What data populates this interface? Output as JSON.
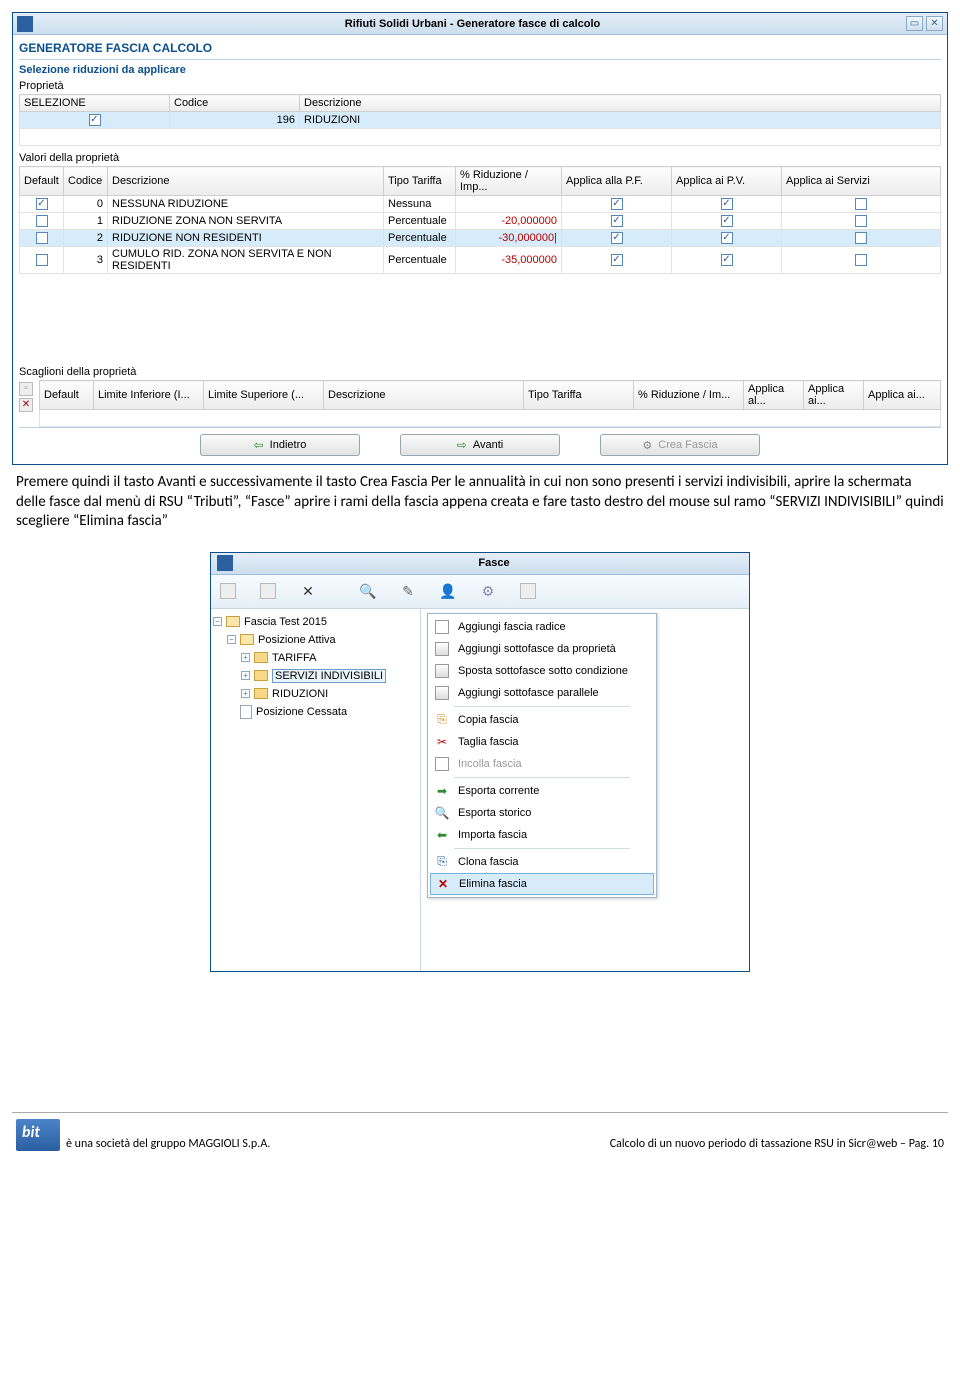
{
  "dialog": {
    "title": "Rifiuti Solidi Urbani - Generatore fasce di calcolo",
    "header": "GENERATORE FASCIA CALCOLO",
    "section1": "Selezione riduzioni da applicare",
    "proprieta_label": "Proprietà",
    "table1_headers": {
      "selezione": "SELEZIONE",
      "codice": "Codice",
      "descrizione": "Descrizione"
    },
    "table1_row": {
      "codice": "196",
      "descrizione": "RIDUZIONI"
    },
    "valori_label": "Valori della proprietà",
    "table2_headers": {
      "default": "Default",
      "codice": "Codice",
      "descrizione": "Descrizione",
      "tipo": "Tipo Tariffa",
      "perc": "% Riduzione / Imp...",
      "pf": "Applica alla P.F.",
      "pv": "Applica ai P.V.",
      "serv": "Applica ai Servizi"
    },
    "table2_rows": [
      {
        "default": true,
        "codice": "0",
        "descrizione": "NESSUNA RIDUZIONE",
        "tipo": "Nessuna",
        "perc": "",
        "pf": true,
        "pv": true,
        "serv": false,
        "sel": false
      },
      {
        "default": false,
        "codice": "1",
        "descrizione": "RIDUZIONE ZONA NON SERVITA",
        "tipo": "Percentuale",
        "perc": "-20,000000",
        "pf": true,
        "pv": true,
        "serv": false,
        "sel": false
      },
      {
        "default": false,
        "codice": "2",
        "descrizione": "RIDUZIONE NON RESIDENTI",
        "tipo": "Percentuale",
        "perc": "-30,000000|",
        "pf": true,
        "pv": true,
        "serv": false,
        "sel": true
      },
      {
        "default": false,
        "codice": "3",
        "descrizione": "CUMULO RID. ZONA NON SERVITA E NON RESIDENTI",
        "tipo": "Percentuale",
        "perc": "-35,000000",
        "pf": true,
        "pv": true,
        "serv": false,
        "sel": false
      }
    ],
    "scaglioni_label": "Scaglioni della proprietà",
    "table3_headers": {
      "default": "Default",
      "liminf": "Limite Inferiore (I...",
      "limsup": "Limite Superiore (...",
      "descrizione": "Descrizione",
      "tipo": "Tipo Tariffa",
      "perc": "% Riduzione / Im...",
      "a1": "Applica al...",
      "a2": "Applica ai...",
      "a3": "Applica ai..."
    },
    "buttons": {
      "indietro": "Indietro",
      "avanti": "Avanti",
      "crea": "Crea Fascia"
    }
  },
  "body_text": "Premere quindi il tasto Avanti e successivamente il tasto Crea Fascia\nPer le annualità in cui non sono presenti i servizi indivisibili, aprire la schermata delle fasce dal menù di RSU “Tributi”, “Fasce” aprire i rami della fascia appena creata e fare tasto destro del mouse sul ramo “SERVIZI INDIVISIBILI” quindi scegliere “Elimina fascia”",
  "dialog2": {
    "title": "Fasce",
    "tree": [
      {
        "indent": 0,
        "exp": "-",
        "icon": "folder-open",
        "label": "Fascia Test 2015"
      },
      {
        "indent": 1,
        "exp": "-",
        "icon": "folder-open",
        "label": "Posizione Attiva"
      },
      {
        "indent": 2,
        "exp": "+",
        "icon": "folder",
        "label": "TARIFFA"
      },
      {
        "indent": 2,
        "exp": "+",
        "icon": "folder",
        "label": "SERVIZI INDIVISIBILI",
        "selected": true
      },
      {
        "indent": 2,
        "exp": "+",
        "icon": "folder",
        "label": "RIDUZIONI"
      },
      {
        "indent": 1,
        "exp": "",
        "icon": "doc",
        "label": "Posizione Cessata"
      }
    ],
    "menu": [
      {
        "icon": "box",
        "label": "Aggiungi fascia radice"
      },
      {
        "icon": "box2",
        "label": "Aggiungi sottofasce da proprietà"
      },
      {
        "icon": "box2",
        "label": "Sposta sottofasce sotto condizione"
      },
      {
        "icon": "box2",
        "label": "Aggiungi sottofasce parallele"
      },
      {
        "sep": true
      },
      {
        "icon": "copy",
        "label": "Copia fascia"
      },
      {
        "icon": "cut",
        "label": "Taglia fascia"
      },
      {
        "icon": "box",
        "label": "Incolla fascia",
        "disabled": true
      },
      {
        "sep": true
      },
      {
        "icon": "arrR",
        "label": "Esporta corrente"
      },
      {
        "icon": "mag",
        "label": "Esporta storico"
      },
      {
        "icon": "arrL",
        "label": "Importa fascia"
      },
      {
        "sep": true
      },
      {
        "icon": "cln",
        "label": "Clona fascia"
      },
      {
        "icon": "del",
        "label": "Elimina fascia",
        "selected": true
      }
    ]
  },
  "footer": {
    "left": "è una società del gruppo MAGGIOLI S.p.A.",
    "right": "Calcolo di un nuovo periodo di tassazione RSU in Sicr@web – Pag. 10"
  }
}
